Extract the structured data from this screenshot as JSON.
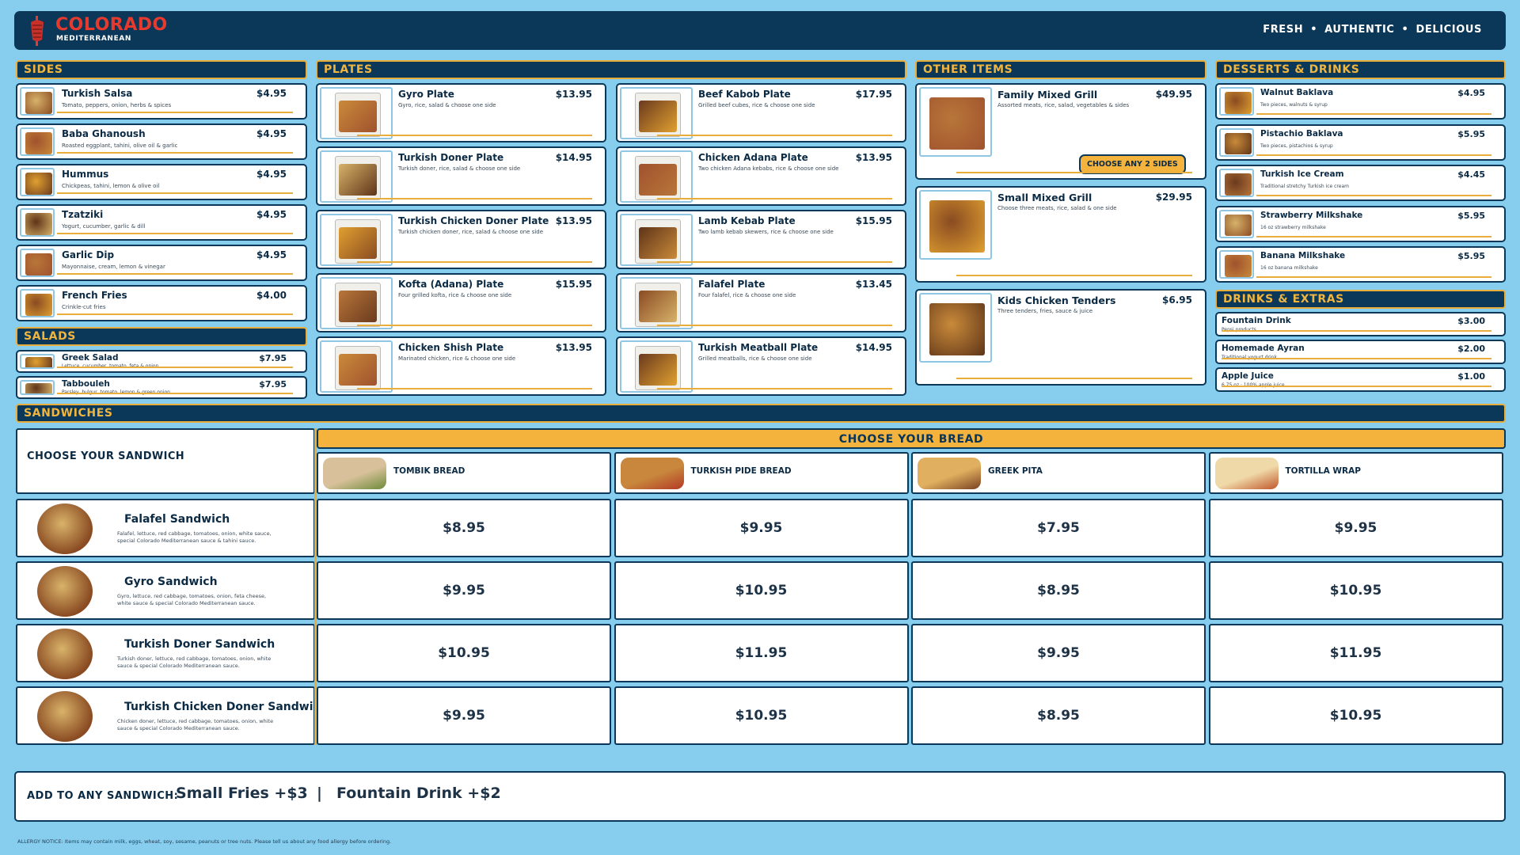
{
  "header": {
    "brand": "COLORADO",
    "brand_sub": "MEDITERRANEAN",
    "tagline": [
      "FRESH",
      "AUTHENTIC",
      "DELICIOUS"
    ],
    "tagline_sep": "•"
  },
  "colors": {
    "navy": "#0b3858",
    "gold": "#f4b33d",
    "red": "#e63a2e",
    "sky": "#87ceee"
  },
  "sides": {
    "title": "SIDES",
    "items": [
      {
        "name": "Turkish Salsa",
        "desc": "Tomato, peppers, onion, herbs & spices",
        "price": "$4.95"
      },
      {
        "name": "Baba Ghanoush",
        "desc": "Roasted eggplant, tahini, olive oil & garlic",
        "price": "$4.95"
      },
      {
        "name": "Hummus",
        "desc": "Chickpeas, tahini, lemon & olive oil",
        "price": "$4.95"
      },
      {
        "name": "Tzatziki",
        "desc": "Yogurt, cucumber, garlic & dill",
        "price": "$4.95"
      },
      {
        "name": "Garlic Dip",
        "desc": "Mayonnaise, cream, lemon & vinegar",
        "price": "$4.95"
      },
      {
        "name": "French Fries",
        "desc": "Crinkle-cut fries",
        "price": "$4.00"
      }
    ]
  },
  "salads": {
    "title": "SALADS",
    "items": [
      {
        "name": "Greek Salad",
        "desc": "Lettuce, cucumber, tomato, feta & onion",
        "price": "$7.95"
      },
      {
        "name": "Tabbouleh",
        "desc": "Parsley, bulgur, tomato, lemon & green onion",
        "price": "$7.95"
      }
    ]
  },
  "plates": {
    "title": "PLATES",
    "items": [
      {
        "name": "Gyro Plate",
        "desc": "Gyro, rice, salad & choose one side",
        "price": "$13.95"
      },
      {
        "name": "Beef Kabob Plate",
        "desc": "Grilled beef cubes, rice & choose one side",
        "price": "$17.95"
      },
      {
        "name": "Turkish Doner Plate",
        "desc": "Turkish doner, rice, salad & choose one side",
        "price": "$14.95"
      },
      {
        "name": "Chicken Adana Plate",
        "desc": "Two chicken Adana kebabs, rice & choose one side",
        "price": "$13.95"
      },
      {
        "name": "Turkish Chicken Doner Plate",
        "desc": "Turkish chicken doner, rice, salad & choose one side",
        "price": "$13.95"
      },
      {
        "name": "Lamb Kebab Plate",
        "desc": "Two lamb kebab skewers, rice & choose one side",
        "price": "$15.95"
      },
      {
        "name": "Kofta (Adana) Plate",
        "desc": "Four grilled kofta, rice & choose one side",
        "price": "$15.95"
      },
      {
        "name": "Falafel Plate",
        "desc": "Four falafel, rice & choose one side",
        "price": "$13.45"
      },
      {
        "name": "Chicken Shish Plate",
        "desc": "Marinated chicken, rice & choose one side",
        "price": "$13.95"
      },
      {
        "name": "Turkish Meatball Plate",
        "desc": "Grilled meatballs, rice & choose one side",
        "price": "$14.95"
      }
    ]
  },
  "other": {
    "title": "OTHER ITEMS",
    "items": [
      {
        "name": "Family Mixed Grill",
        "desc": "Assorted meats, rice, salad, vegetables & sides",
        "price": "$49.95",
        "badge": "CHOOSE ANY 2 SIDES"
      },
      {
        "name": "Small Mixed Grill",
        "desc": "Choose three meats, rice, salad & one side",
        "price": "$29.95"
      },
      {
        "name": "Kids Chicken Tenders",
        "desc": "Three tenders, fries, sauce & juice",
        "price": "$6.95"
      }
    ]
  },
  "desserts": {
    "title": "DESSERTS & DRINKS",
    "items": [
      {
        "name": "Walnut Baklava",
        "desc": "Two pieces, walnuts & syrup",
        "price": "$4.95"
      },
      {
        "name": "Pistachio Baklava",
        "desc": "Two pieces, pistachios & syrup",
        "price": "$5.95"
      },
      {
        "name": "Turkish Ice Cream",
        "desc": "Traditional stretchy Turkish ice cream",
        "price": "$4.45"
      },
      {
        "name": "Strawberry Milkshake",
        "desc": "16 oz strawberry milkshake",
        "price": "$5.95"
      },
      {
        "name": "Banana Milkshake",
        "desc": "16 oz banana milkshake",
        "price": "$5.95"
      }
    ]
  },
  "drinks": {
    "title": "DRINKS & EXTRAS",
    "items": [
      {
        "name": "Fountain Drink",
        "desc": "Pepsi products",
        "price": "$3.00"
      },
      {
        "name": "Homemade Ayran",
        "desc": "Traditional yogurt drink",
        "price": "$2.00"
      },
      {
        "name": "Apple Juice",
        "desc": "6.75 oz · 100% apple juice",
        "price": "$1.00"
      }
    ]
  },
  "sandwiches": {
    "title": "SANDWICHES",
    "choose_label": "CHOOSE YOUR SANDWICH",
    "bread_header": "CHOOSE YOUR BREAD",
    "breads": [
      "TOMBIK BREAD",
      "TURKISH PIDE BREAD",
      "GREEK PITA",
      "TORTILLA WRAP"
    ],
    "rows": [
      {
        "name": "Falafel Sandwich",
        "desc": "Falafel, lettuce, red cabbage, tomatoes, onion, white sauce, special Colorado Mediterranean sauce & tahini sauce.",
        "prices": [
          "$8.95",
          "$9.95",
          "$7.95",
          "$9.95"
        ]
      },
      {
        "name": "Gyro Sandwich",
        "desc": "Gyro, lettuce, red cabbage, tomatoes, onion, feta cheese, white sauce & special Colorado Mediterranean sauce.",
        "prices": [
          "$9.95",
          "$10.95",
          "$8.95",
          "$10.95"
        ]
      },
      {
        "name": "Turkish Doner Sandwich",
        "desc": "Turkish doner, lettuce, red cabbage, tomatoes, onion, white sauce & special Colorado Mediterranean sauce.",
        "prices": [
          "$10.95",
          "$11.95",
          "$9.95",
          "$11.95"
        ]
      },
      {
        "name": "Turkish Chicken Doner Sandwich",
        "desc": "Chicken doner, lettuce, red cabbage, tomatoes, onion, white sauce & special Colorado Mediterranean sauce.",
        "prices": [
          "$9.95",
          "$10.95",
          "$8.95",
          "$10.95"
        ]
      }
    ]
  },
  "addon": {
    "label": "ADD TO ANY SANDWICH:",
    "option1": "Small Fries +$3",
    "sep": "|",
    "option2": "Fountain Drink +$2"
  },
  "allergy": "ALLERGY NOTICE: Items may contain milk, eggs, wheat, soy, sesame, peanuts or tree nuts. Please tell us about any food allergy before ordering."
}
